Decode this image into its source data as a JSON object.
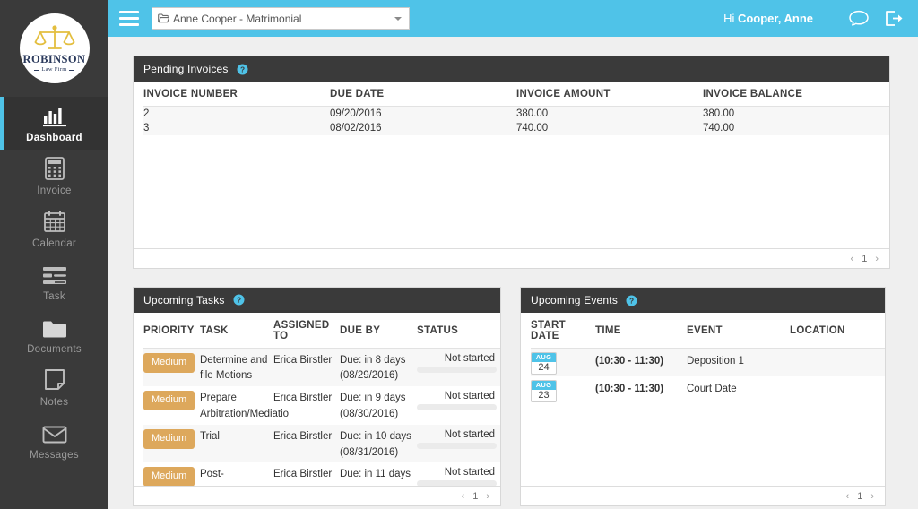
{
  "brand": {
    "logo_name": "ROBINSON",
    "logo_sub": "Law Firm",
    "accent_color": "#4FC3E8",
    "sidebar_color": "#3a3a3a",
    "badge_color": "#DDA85C"
  },
  "sidebar": {
    "items": [
      {
        "label": "Dashboard",
        "icon": "bar-chart-icon",
        "active": true
      },
      {
        "label": "Invoice",
        "icon": "calculator-icon",
        "active": false
      },
      {
        "label": "Calendar",
        "icon": "calendar-icon",
        "active": false
      },
      {
        "label": "Task",
        "icon": "task-list-icon",
        "active": false
      },
      {
        "label": "Documents",
        "icon": "folder-icon",
        "active": false
      },
      {
        "label": "Notes",
        "icon": "note-icon",
        "active": false
      },
      {
        "label": "Messages",
        "icon": "envelope-icon",
        "active": false
      }
    ]
  },
  "topbar": {
    "menu_icon": "hamburger-icon",
    "case_selector": {
      "value": "Anne Cooper - Matrimonial",
      "icon": "open-folder-icon"
    },
    "greeting_prefix": "Hi ",
    "user_name": "Cooper, Anne",
    "chat_icon": "chat-bubble-icon",
    "logout_icon": "logout-icon"
  },
  "panels": {
    "pending_invoices": {
      "title": "Pending Invoices",
      "help_icon": "help-circle-icon",
      "columns": [
        "INVOICE NUMBER",
        "DUE DATE",
        "INVOICE AMOUNT",
        "INVOICE BALANCE"
      ],
      "rows": [
        {
          "number": "2",
          "due_date": "09/20/2016",
          "amount": "380.00",
          "balance": "380.00"
        },
        {
          "number": "3",
          "due_date": "08/02/2016",
          "amount": "740.00",
          "balance": "740.00"
        }
      ],
      "pager": {
        "prev": "‹",
        "page": "1",
        "next": "›"
      }
    },
    "upcoming_tasks": {
      "title": "Upcoming Tasks",
      "help_icon": "help-circle-icon",
      "columns": [
        "PRIORITY",
        "TASK",
        "ASSIGNED TO",
        "DUE BY",
        "STATUS"
      ],
      "rows": [
        {
          "priority": "Medium",
          "task": "Determine and file Motions",
          "assigned_to": "Erica Birstler",
          "due_by": "Due: in 8 days (08/29/2016)",
          "status": "Not started"
        },
        {
          "priority": "Medium",
          "task": "Prepare Arbitration/Mediatio",
          "assigned_to": "Erica Birstler",
          "due_by": "Due: in 9 days (08/30/2016)",
          "status": "Not started"
        },
        {
          "priority": "Medium",
          "task": "Trial",
          "assigned_to": "Erica Birstler",
          "due_by": "Due: in 10 days (08/31/2016)",
          "status": "Not started"
        },
        {
          "priority": "Medium",
          "task": "Post-",
          "assigned_to": "Erica Birstler",
          "due_by": "Due: in 11 days",
          "status": "Not started"
        }
      ],
      "pager": {
        "prev": "‹",
        "page": "1",
        "next": "›"
      }
    },
    "upcoming_events": {
      "title": "Upcoming Events",
      "help_icon": "help-circle-icon",
      "columns": [
        "START DATE",
        "TIME",
        "EVENT",
        "LOCATION"
      ],
      "rows": [
        {
          "month": "AUG",
          "day": "24",
          "time": "(10:30 - 11:30)",
          "event": "Deposition 1",
          "location": ""
        },
        {
          "month": "AUG",
          "day": "23",
          "time": "(10:30 - 11:30)",
          "event": "Court Date",
          "location": ""
        }
      ],
      "pager": {
        "prev": "‹",
        "page": "1",
        "next": "›"
      }
    }
  }
}
